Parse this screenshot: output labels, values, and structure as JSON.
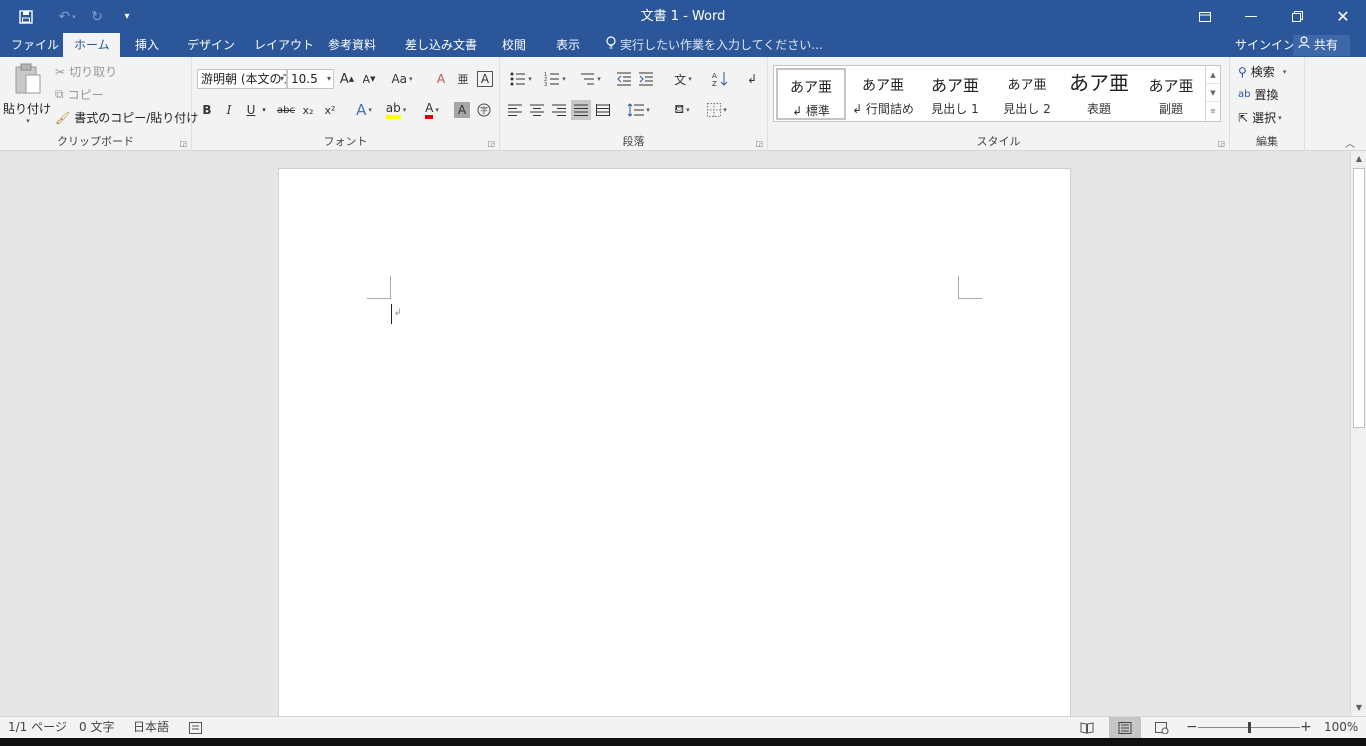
{
  "window": {
    "title": "文書 1 - Word",
    "accent": "#2b579a"
  },
  "qat": {
    "save_icon": "save-icon",
    "undo_icon": "undo-icon",
    "redo_icon": "redo-icon",
    "customize_icon": "customize-icon"
  },
  "tabs": [
    {
      "label": "ファイル"
    },
    {
      "label": "ホーム"
    },
    {
      "label": "挿入"
    },
    {
      "label": "デザイン"
    },
    {
      "label": "レイアウト"
    },
    {
      "label": "参考資料"
    },
    {
      "label": "差し込み文書"
    },
    {
      "label": "校閲"
    },
    {
      "label": "表示"
    }
  ],
  "active_tab": "ホーム",
  "tell_me": "実行したい作業を入力してください...",
  "signin": "サインイン",
  "share": "共有",
  "clipboard": {
    "label": "クリップボード",
    "paste": "貼り付け",
    "cut": "切り取り",
    "copy": "コピー",
    "format_painter": "書式のコピー/貼り付け"
  },
  "font": {
    "label": "フォント",
    "font_name": "游明朝 (本文のフォ",
    "font_size": "10.5",
    "grow": "A",
    "shrink": "A",
    "case": "Aa",
    "bold": "B",
    "italic": "I",
    "underline": "U",
    "strike": "abc",
    "subscript": "x₂",
    "superscript": "x²",
    "font_color_label": "A",
    "shading_label": "A"
  },
  "paragraph": {
    "label": "段落"
  },
  "styles": {
    "label": "スタイル",
    "items": [
      {
        "preview": "あア亜",
        "name": "↲ 標準"
      },
      {
        "preview": "あア亜",
        "name": "↲ 行間詰め"
      },
      {
        "preview": "あア亜",
        "name": "見出し 1"
      },
      {
        "preview": "あア亜",
        "name": "見出し 2"
      },
      {
        "preview": "あア亜",
        "name": "表題"
      },
      {
        "preview": "あア亜",
        "name": "副題"
      }
    ]
  },
  "editing": {
    "label": "編集",
    "find": "検索",
    "replace": "置換",
    "select": "選択"
  },
  "document": {
    "paragraph_mark": "↲"
  },
  "status": {
    "page": "1/1 ページ",
    "words": "0 文字",
    "language": "日本語",
    "zoom": "100%",
    "zoom_level": 1.0
  }
}
